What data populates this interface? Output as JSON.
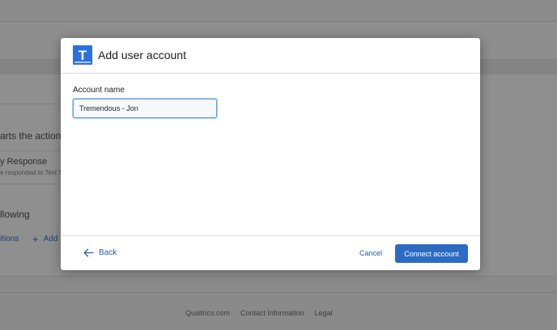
{
  "background": {
    "action_text": "arts the action o",
    "response_title": "y Response",
    "response_subtitle": "e responded to Test S",
    "following_text": "llowing",
    "conditions_link": "itions",
    "add_link": "Add",
    "footer": {
      "qualtrics": "Qualtrics.com",
      "contact": "Contact Information",
      "legal": "Legal"
    }
  },
  "modal": {
    "title": "Add user account",
    "logo_letter": "T",
    "field_label": "Account name",
    "account_name_value": "Tremendous - Jon",
    "back_label": "Back",
    "cancel_label": "Cancel",
    "connect_label": "Connect account"
  },
  "colors": {
    "accent": "#2c6bc4",
    "link": "#1f5fae",
    "logo_bg": "#2b6fe0",
    "overlay": "#8f8f8f"
  }
}
